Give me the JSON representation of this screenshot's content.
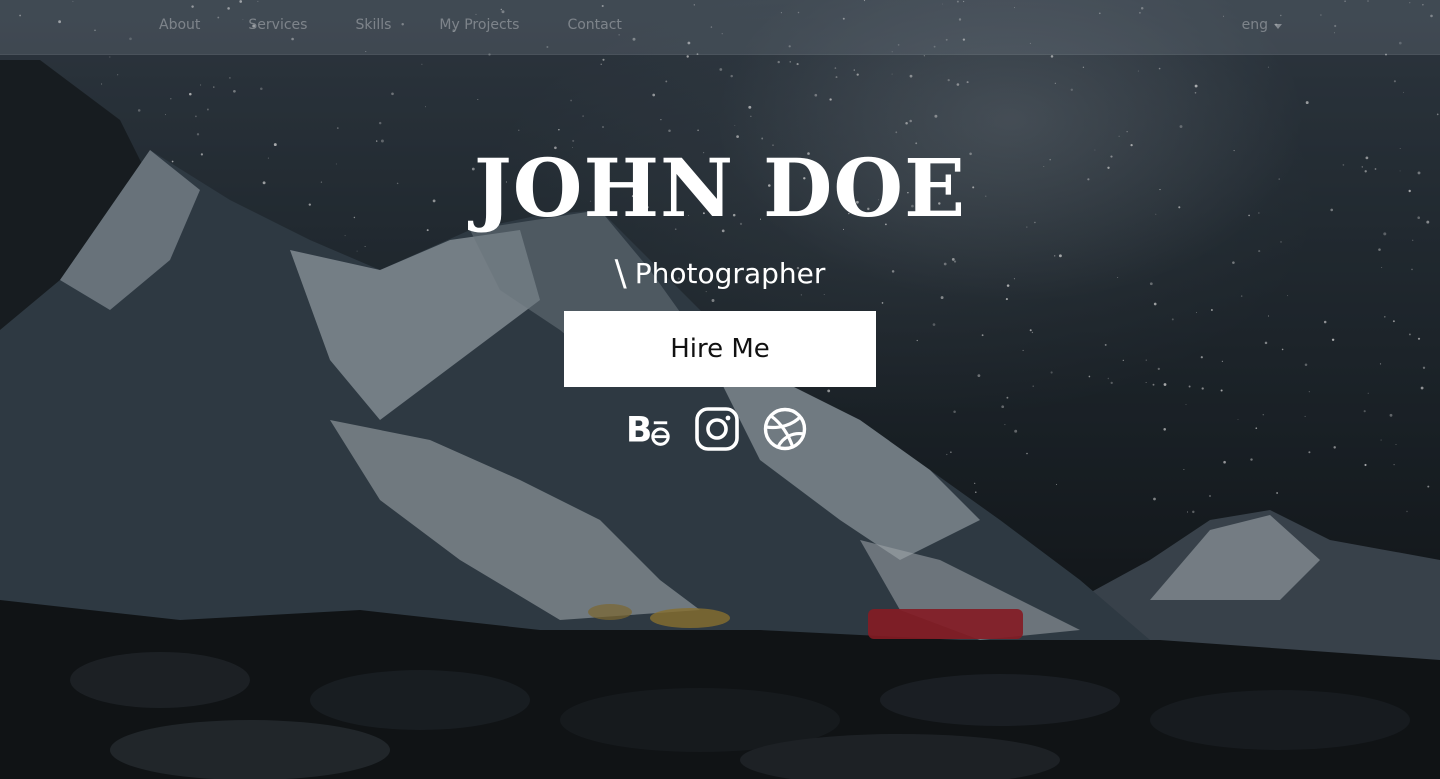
{
  "nav": {
    "links": [
      "About",
      "Services",
      "Skills",
      "My Projects",
      "Contact"
    ],
    "language": "eng"
  },
  "hero": {
    "name": "JOHN DOE",
    "slash": "\\",
    "role": "Photographer",
    "cta_label": "Hire Me"
  },
  "socials": [
    {
      "icon": "behance-icon"
    },
    {
      "icon": "instagram-icon"
    },
    {
      "icon": "dribbble-icon"
    }
  ],
  "colors": {
    "text": "#ffffff",
    "button_bg": "#ffffff",
    "button_text": "#111111"
  }
}
